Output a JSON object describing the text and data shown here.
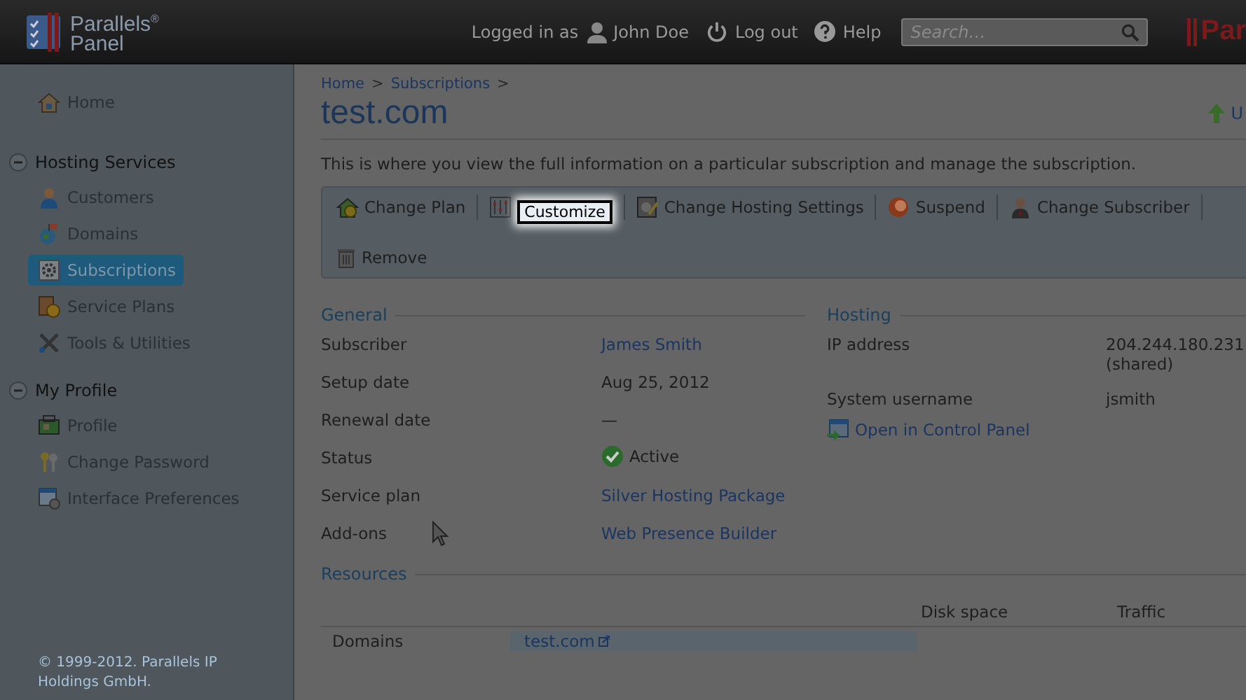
{
  "header": {
    "logo_line_1": "Parallels",
    "logo_mark": "®",
    "logo_line_2": "Panel",
    "logged_in_label": "Logged in as",
    "user_name": "John Doe",
    "logout": "Log out",
    "help": "Help",
    "search": {
      "placeholder": "Search…"
    },
    "brand_cut": "Par"
  },
  "sidebar": {
    "items": [
      {
        "kind": "link",
        "label": "Home",
        "selected": false
      },
      {
        "kind": "group",
        "label": "Hosting Services",
        "expanded": true,
        "children": [
          {
            "label": "Customers",
            "selected": false
          },
          {
            "label": "Domains",
            "selected": false
          },
          {
            "label": "Subscriptions",
            "selected": true
          },
          {
            "label": "Service Plans",
            "selected": false
          },
          {
            "label": "Tools & Utilities",
            "selected": false
          }
        ]
      },
      {
        "kind": "group",
        "label": "My Profile",
        "expanded": true,
        "children": [
          {
            "label": "Profile",
            "selected": false
          },
          {
            "label": "Change Password",
            "selected": false
          },
          {
            "label": "Interface Preferences",
            "selected": false
          }
        ]
      }
    ],
    "copyright": "© 1999-2012. Parallels IP Holdings GmbH."
  },
  "main": {
    "breadcrumbs": [
      {
        "label": "Home"
      },
      {
        "label": "Subscriptions"
      }
    ],
    "breadcrumb_separator": ">",
    "title": "test.com",
    "upgrade_link_cut": "U",
    "description": "This is where you view the full information on a particular subscription and manage the subscription.",
    "toolbar": {
      "actions": [
        {
          "label": "Change Plan",
          "highlighted": false
        },
        {
          "label": "Customize",
          "highlighted": true
        },
        {
          "label": "Change Hosting Settings",
          "highlighted": false
        },
        {
          "label": "Suspend",
          "highlighted": false
        },
        {
          "label": "Change Subscriber",
          "highlighted": false
        },
        {
          "label": "Remove",
          "highlighted": false
        }
      ]
    },
    "general": {
      "heading": "General",
      "rows": [
        {
          "label": "Subscriber",
          "value": "James Smith",
          "kind": "link"
        },
        {
          "label": "Setup date",
          "value": "Aug 25, 2012",
          "kind": "text"
        },
        {
          "label": "Renewal date",
          "value": "—",
          "kind": "text"
        },
        {
          "label": "Status",
          "value": "Active",
          "kind": "status"
        },
        {
          "label": "Service plan",
          "value": "Silver Hosting Package",
          "kind": "link"
        },
        {
          "label": "Add-ons",
          "value": "Web Presence Builder",
          "kind": "link"
        }
      ]
    },
    "hosting": {
      "heading": "Hosting",
      "rows": [
        {
          "label": "IP address",
          "value": "204.244.180.231",
          "note": "(shared)"
        },
        {
          "label": "System username",
          "value": "jsmith"
        }
      ],
      "control_panel_link": "Open in Control Panel"
    },
    "resources": {
      "heading": "Resources",
      "columns": [
        "Disk space",
        "Traffic"
      ],
      "rows": [
        {
          "label": "Domains",
          "value": "test.com"
        }
      ]
    }
  }
}
